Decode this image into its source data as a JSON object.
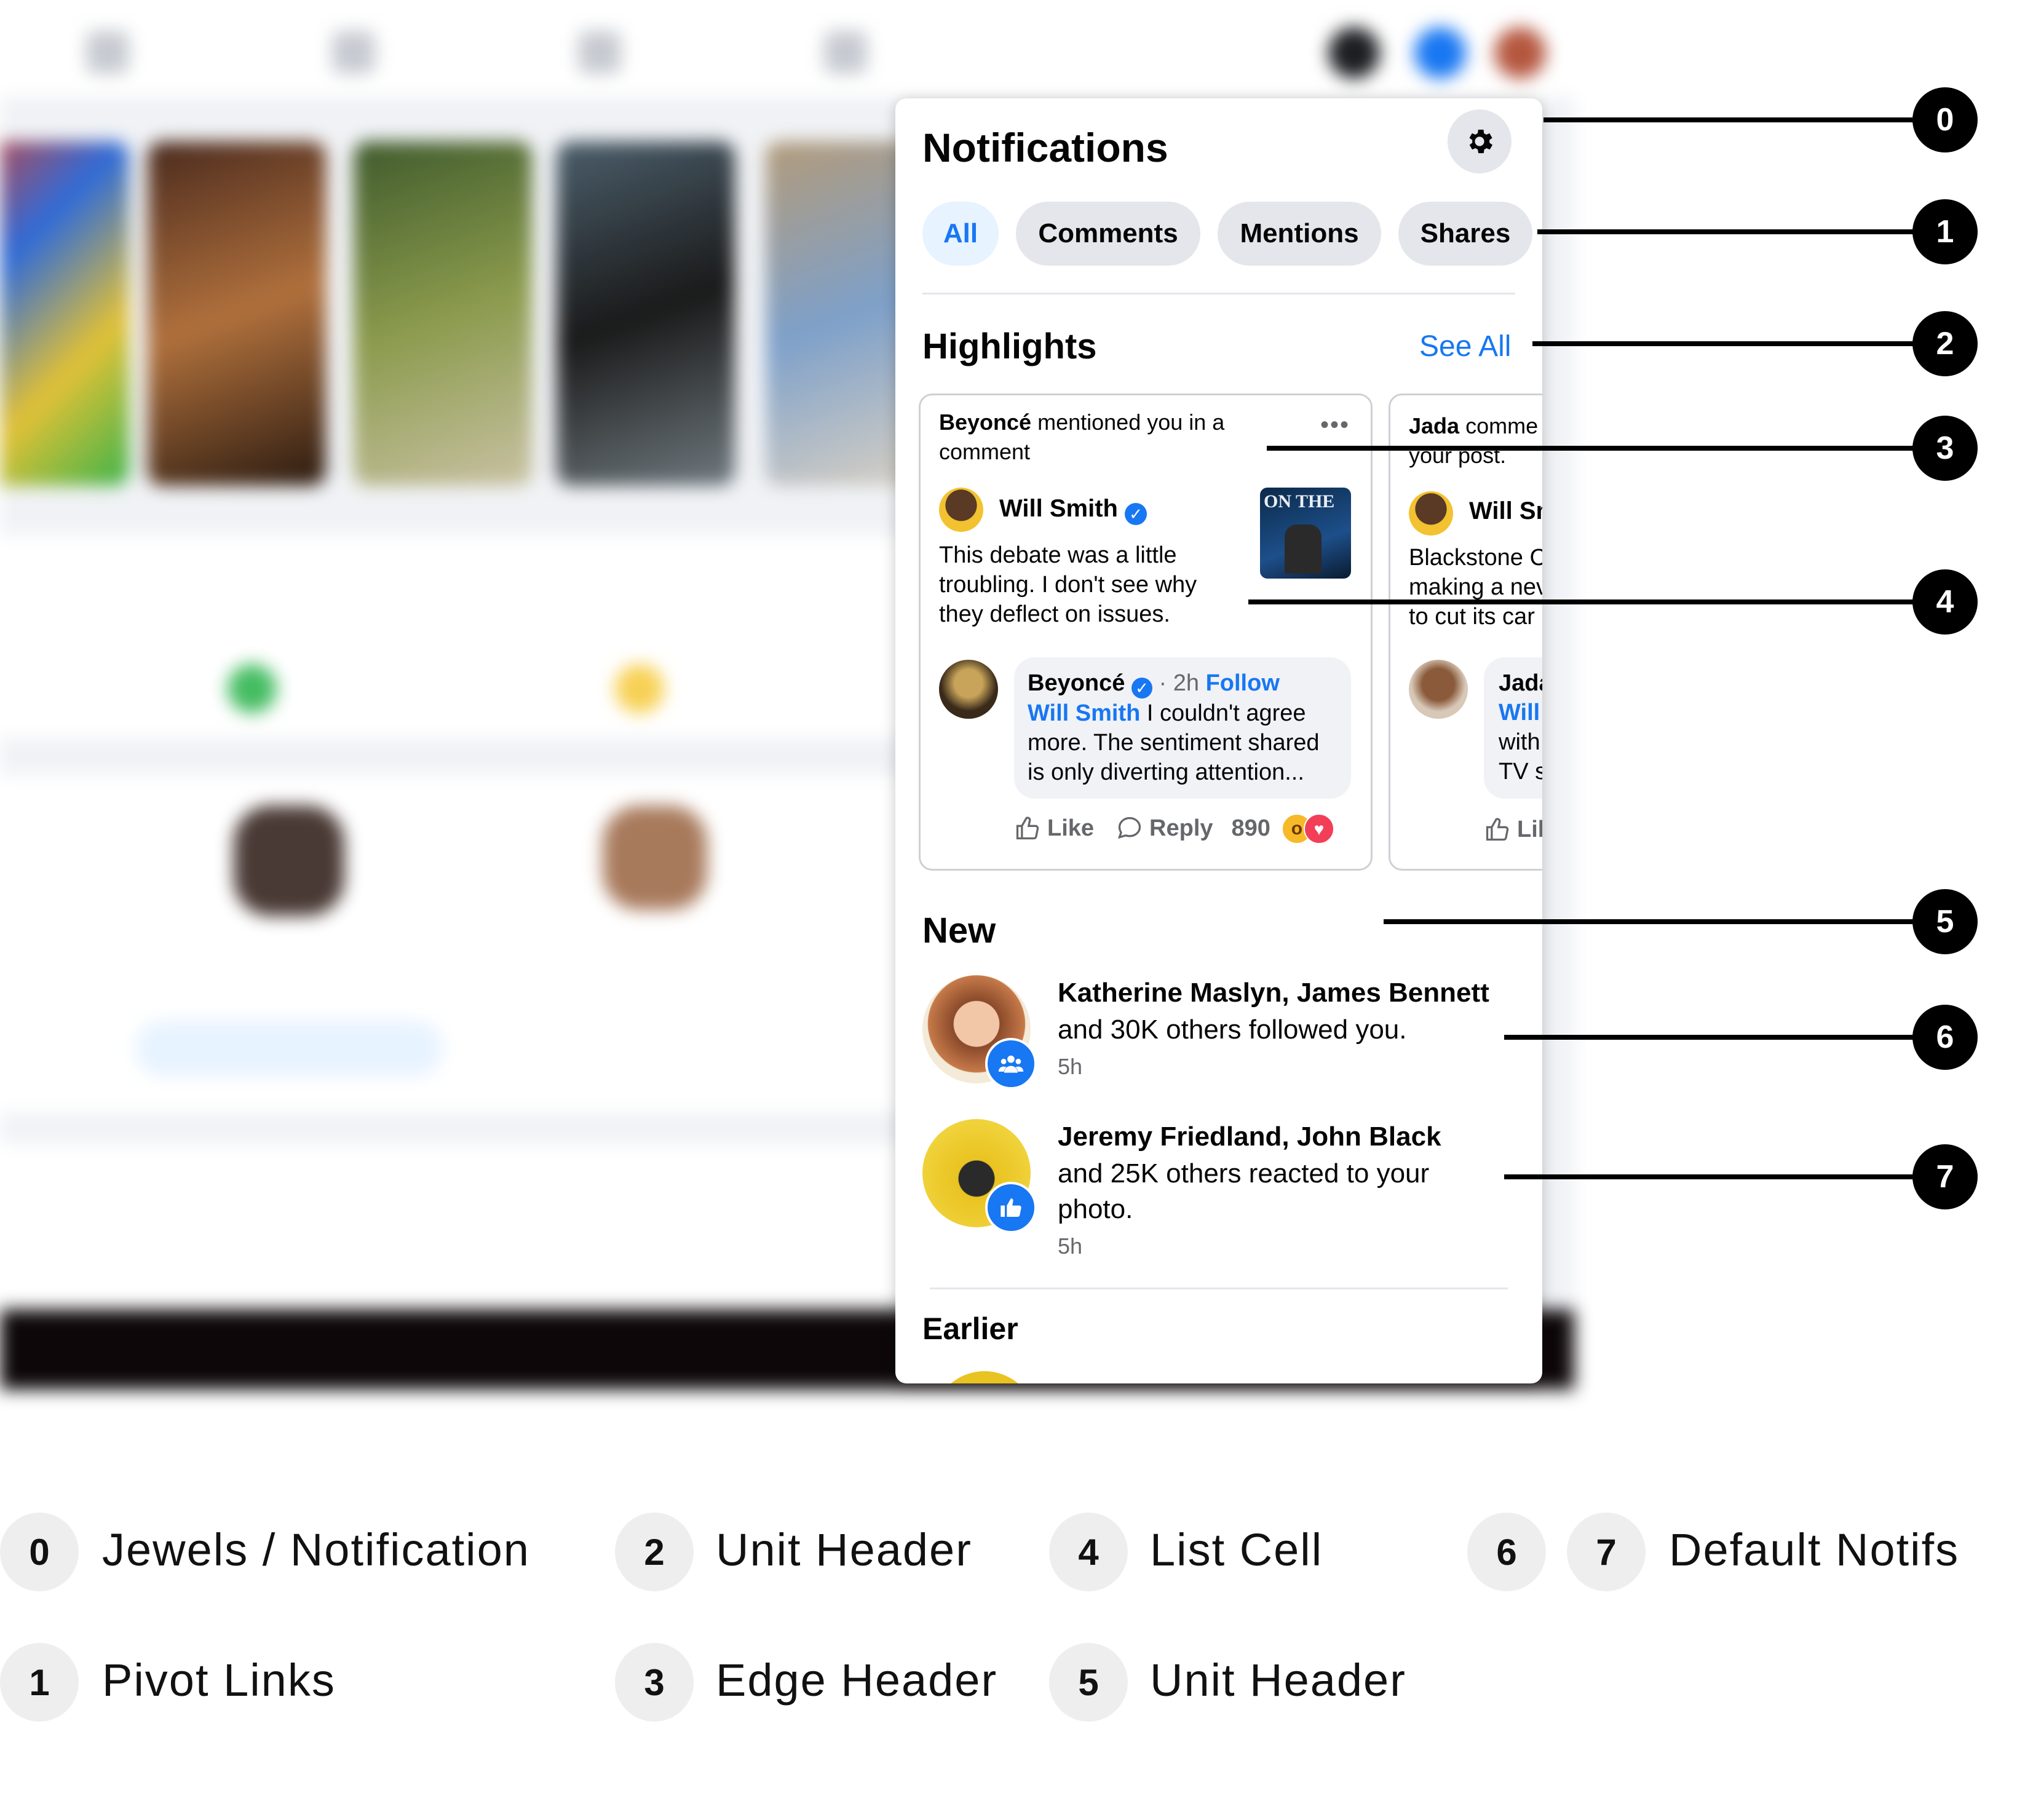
{
  "notifications_panel": {
    "title": "Notifications",
    "settings_icon": "gear-icon",
    "pivots": [
      {
        "label": "All",
        "active": true
      },
      {
        "label": "Comments",
        "active": false
      },
      {
        "label": "Mentions",
        "active": false
      },
      {
        "label": "Shares",
        "active": false
      }
    ],
    "highlights": {
      "header": "Highlights",
      "see_all": "See All",
      "cards": [
        {
          "actor": "Beyoncé",
          "edge_text": "mentioned you in a comment",
          "author": "Will Smith",
          "post_text": "This debate was a little troubling. I don't see why they deflect on issues.",
          "thumbnail_text": "ON THE",
          "comment_author": "Beyoncé",
          "comment_time": "· 2h",
          "follow": "Follow",
          "comment_mention": "Will Smith",
          "comment_text": "I couldn't agree more. The sentiment shared is only diverting attention...",
          "like": "Like",
          "reply": "Reply",
          "reaction_count": "890"
        },
        {
          "actor": "Jada",
          "edge_text": "comme",
          "edge_text_line2": "your post.",
          "author": "Will Sm",
          "post_line1": "Blackstone C",
          "post_line2": "making a nev",
          "post_line3": "to cut its car",
          "comment_author": "Jada",
          "comment_line1": "Will",
          "comment_line2": "with",
          "comment_line3": "TV s",
          "like": "Lil"
        }
      ]
    },
    "new_section": {
      "header": "New",
      "items": [
        {
          "names": "Katherine Maslyn, James Bennett",
          "text": "and 30K others followed you.",
          "time": "5h",
          "badge_icon": "group-icon",
          "badge_color": "#1877f2"
        },
        {
          "names": "Jeremy Friedland, John Black",
          "text": "and 25K others reacted to your photo.",
          "time": "5h",
          "badge_icon": "thumbs-up-icon",
          "badge_color": "#1877f2"
        }
      ]
    },
    "earlier_section": {
      "header": "Earlier"
    }
  },
  "callouts": [
    "0",
    "1",
    "2",
    "3",
    "4",
    "5",
    "6",
    "7"
  ],
  "legend": [
    {
      "nums": [
        "0"
      ],
      "label": "Jewels / Notification"
    },
    {
      "nums": [
        "1"
      ],
      "label": "Pivot Links"
    },
    {
      "nums": [
        "2"
      ],
      "label": "Unit Header"
    },
    {
      "nums": [
        "3"
      ],
      "label": "Edge Header"
    },
    {
      "nums": [
        "4"
      ],
      "label": "List Cell"
    },
    {
      "nums": [
        "5"
      ],
      "label": "Unit Header"
    },
    {
      "nums": [
        "6",
        "7"
      ],
      "label": "Default Notifs"
    }
  ],
  "colors": {
    "accent": "#1877f2",
    "active_pivot_bg": "#e7f3ff",
    "pill_bg": "#e4e6eb"
  }
}
